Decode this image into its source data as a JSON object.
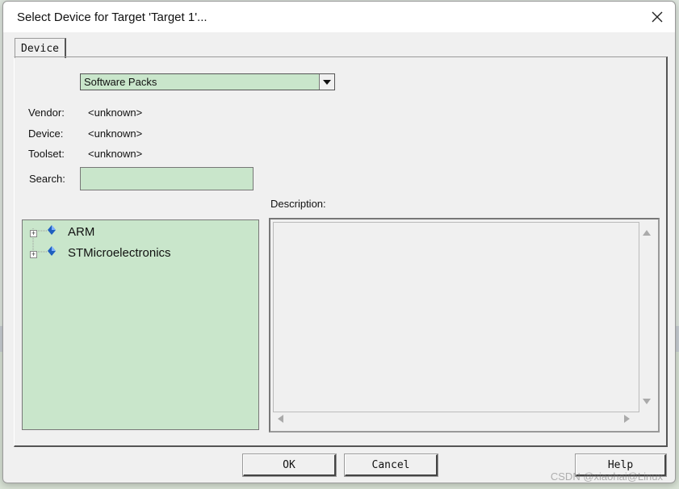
{
  "window": {
    "title": "Select Device for Target 'Target 1'..."
  },
  "tabs": [
    {
      "label": "Device"
    }
  ],
  "source_select": {
    "value": "Software Packs"
  },
  "info": {
    "vendor_label": "Vendor:",
    "vendor_value": "<unknown>",
    "device_label": "Device:",
    "device_value": "<unknown>",
    "toolset_label": "Toolset:",
    "toolset_value": "<unknown>"
  },
  "search": {
    "label": "Search:",
    "value": ""
  },
  "description": {
    "label": "Description:"
  },
  "tree": {
    "items": [
      {
        "label": "ARM"
      },
      {
        "label": "STMicroelectronics"
      }
    ]
  },
  "buttons": {
    "ok": "OK",
    "cancel": "Cancel",
    "help": "Help"
  },
  "watermark": "CSDN @xiaohai@Linux",
  "colors": {
    "field_bg": "#c9e6cb",
    "dialog_bg": "#f0f0f0",
    "accent_icon": "#1f5fbf"
  }
}
